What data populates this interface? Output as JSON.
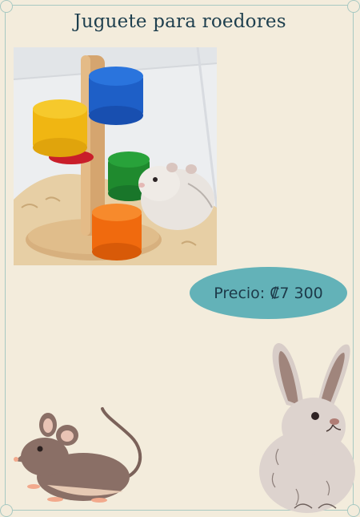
{
  "title": "Juguete para roedores",
  "price": {
    "label": "Precio:",
    "value": "₡7 300"
  },
  "colors": {
    "background": "#f3ecdc",
    "title": "#1e3f4e",
    "price_pill": "#63b2b8",
    "frame": "#a8c9c2"
  },
  "icons": {
    "product": "hamster-toy-photo",
    "rabbit": "rabbit-illustration",
    "mouse": "mouse-illustration"
  }
}
